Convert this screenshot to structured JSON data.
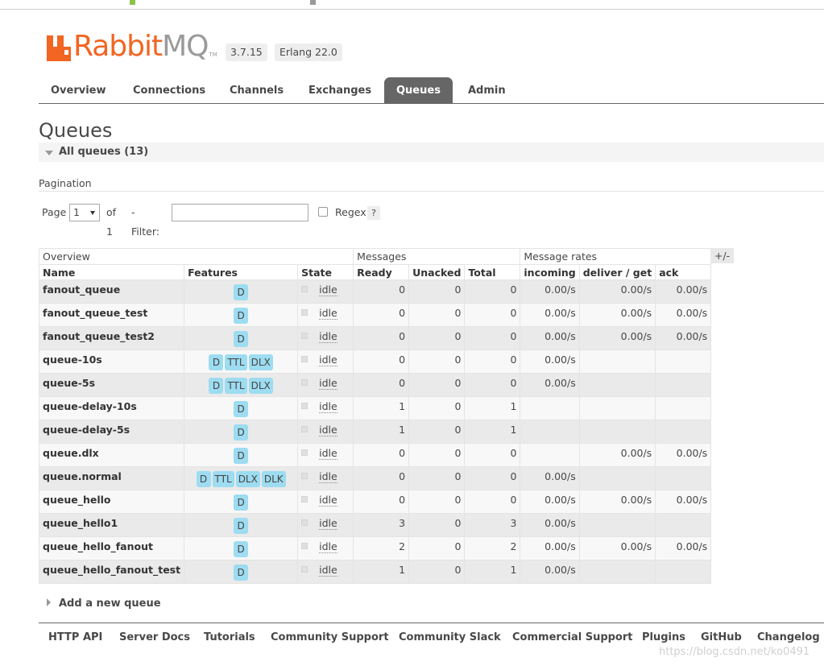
{
  "header": {
    "logo_rabbit": "Rabbit",
    "logo_mq": "MQ",
    "logo_tm": "TM",
    "version": "3.7.15",
    "erlang": "Erlang 22.0"
  },
  "tabs": [
    {
      "label": "Overview",
      "active": false
    },
    {
      "label": "Connections",
      "active": false
    },
    {
      "label": "Channels",
      "active": false
    },
    {
      "label": "Exchanges",
      "active": false
    },
    {
      "label": "Queues",
      "active": true
    },
    {
      "label": "Admin",
      "active": false
    }
  ],
  "page": {
    "title": "Queues",
    "section_label": "All queues (13)"
  },
  "pagination": {
    "title": "Pagination",
    "page_label": "Page",
    "page_value": "1",
    "of_label": "of 1",
    "filter_label": "- Filter:",
    "filter_value": "",
    "regex_label": "Regex",
    "help_label": "?"
  },
  "table": {
    "groups": {
      "overview": "Overview",
      "messages": "Messages",
      "rates": "Message rates"
    },
    "toggle_columns": "+/-",
    "columns": [
      "Name",
      "Features",
      "State",
      "Ready",
      "Unacked",
      "Total",
      "incoming",
      "deliver / get",
      "ack"
    ],
    "rows": [
      {
        "name": "fanout_queue",
        "features": [
          "D"
        ],
        "state": "idle",
        "ready": "0",
        "unacked": "0",
        "total": "0",
        "incoming": "0.00/s",
        "deliver": "0.00/s",
        "ack": "0.00/s"
      },
      {
        "name": "fanout_queue_test",
        "features": [
          "D"
        ],
        "state": "idle",
        "ready": "0",
        "unacked": "0",
        "total": "0",
        "incoming": "0.00/s",
        "deliver": "0.00/s",
        "ack": "0.00/s"
      },
      {
        "name": "fanout_queue_test2",
        "features": [
          "D"
        ],
        "state": "idle",
        "ready": "0",
        "unacked": "0",
        "total": "0",
        "incoming": "0.00/s",
        "deliver": "0.00/s",
        "ack": "0.00/s"
      },
      {
        "name": "queue-10s",
        "features": [
          "D",
          "TTL",
          "DLX"
        ],
        "state": "idle",
        "ready": "0",
        "unacked": "0",
        "total": "0",
        "incoming": "0.00/s",
        "deliver": "",
        "ack": ""
      },
      {
        "name": "queue-5s",
        "features": [
          "D",
          "TTL",
          "DLX"
        ],
        "state": "idle",
        "ready": "0",
        "unacked": "0",
        "total": "0",
        "incoming": "0.00/s",
        "deliver": "",
        "ack": ""
      },
      {
        "name": "queue-delay-10s",
        "features": [
          "D"
        ],
        "state": "idle",
        "ready": "1",
        "unacked": "0",
        "total": "1",
        "incoming": "",
        "deliver": "",
        "ack": ""
      },
      {
        "name": "queue-delay-5s",
        "features": [
          "D"
        ],
        "state": "idle",
        "ready": "1",
        "unacked": "0",
        "total": "1",
        "incoming": "",
        "deliver": "",
        "ack": ""
      },
      {
        "name": "queue.dlx",
        "features": [
          "D"
        ],
        "state": "idle",
        "ready": "0",
        "unacked": "0",
        "total": "0",
        "incoming": "",
        "deliver": "0.00/s",
        "ack": "0.00/s"
      },
      {
        "name": "queue.normal",
        "features": [
          "D",
          "TTL",
          "DLX",
          "DLK"
        ],
        "state": "idle",
        "ready": "0",
        "unacked": "0",
        "total": "0",
        "incoming": "0.00/s",
        "deliver": "",
        "ack": ""
      },
      {
        "name": "queue_hello",
        "features": [
          "D"
        ],
        "state": "idle",
        "ready": "0",
        "unacked": "0",
        "total": "0",
        "incoming": "0.00/s",
        "deliver": "0.00/s",
        "ack": "0.00/s"
      },
      {
        "name": "queue_hello1",
        "features": [
          "D"
        ],
        "state": "idle",
        "ready": "3",
        "unacked": "0",
        "total": "3",
        "incoming": "0.00/s",
        "deliver": "",
        "ack": ""
      },
      {
        "name": "queue_hello_fanout",
        "features": [
          "D"
        ],
        "state": "idle",
        "ready": "2",
        "unacked": "0",
        "total": "2",
        "incoming": "0.00/s",
        "deliver": "0.00/s",
        "ack": "0.00/s"
      },
      {
        "name": "queue_hello_fanout_test",
        "features": [
          "D"
        ],
        "state": "idle",
        "ready": "1",
        "unacked": "0",
        "total": "1",
        "incoming": "0.00/s",
        "deliver": "",
        "ack": ""
      }
    ]
  },
  "add_queue_label": "Add a new queue",
  "footer": [
    "HTTP API",
    "Server Docs",
    "Tutorials",
    "Community Support",
    "Community Slack",
    "Commercial Support",
    "Plugins",
    "GitHub",
    "Changelog"
  ],
  "watermark": "https://blog.csdn.net/ko0491"
}
